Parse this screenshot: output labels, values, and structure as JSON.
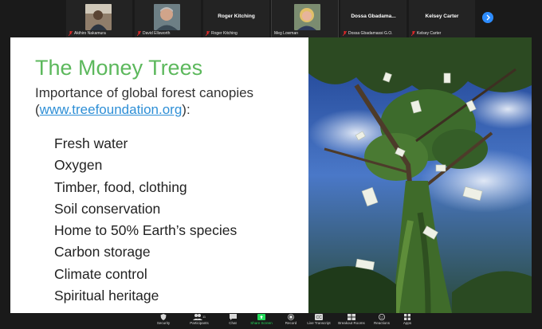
{
  "participants": [
    {
      "name": "Akihiro Nakamura",
      "muted": true,
      "video": true
    },
    {
      "name": "David Ellsworth",
      "muted": true,
      "video": true
    },
    {
      "name": "Roger Kitching",
      "muted": true,
      "video": false
    },
    {
      "name": "Meg Lowman",
      "muted": false,
      "video": true
    },
    {
      "name": "Dossa Gbadamassi G.O.",
      "display_name": "Dossa Gbadama...",
      "muted": true,
      "video": false
    },
    {
      "name": "Kelsey Carter",
      "muted": true,
      "video": false
    }
  ],
  "slide": {
    "title": "The Money Trees",
    "subtitle_line1": "Importance of global forest canopies",
    "subtitle_open": "(",
    "link": "www.treefoundation.org",
    "subtitle_close": "):",
    "items": [
      "Fresh water",
      "Oxygen",
      "Timber, food, clothing",
      "Soil conservation",
      "Home to 50% Earth’s species",
      "Carbon storage",
      "Climate control",
      "Spiritual heritage"
    ]
  },
  "toolbar": {
    "security": "Security",
    "participants": "Participants",
    "participants_count": "111",
    "chat": "Chat",
    "share": "Share Screen",
    "record": "Record",
    "transcript": "Live Transcript",
    "breakout": "Breakout Rooms",
    "reactions": "Reactions",
    "apps": "Apps"
  },
  "colors": {
    "title_green": "#5cb85c",
    "link_blue": "#2e8fd6",
    "accent_blue": "#2d8cff",
    "share_green": "#23d959",
    "mute_red": "#e02828"
  }
}
